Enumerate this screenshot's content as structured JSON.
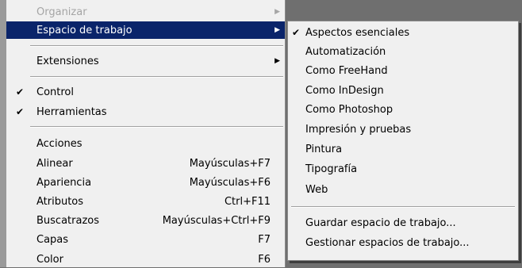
{
  "main_menu": {
    "organize": "Organizar",
    "workspace": "Espacio de trabajo",
    "extensions": "Extensiones",
    "control": "Control",
    "tools": "Herramientas",
    "panels": [
      {
        "label": "Acciones",
        "shortcut": ""
      },
      {
        "label": "Alinear",
        "shortcut": "Mayúsculas+F7"
      },
      {
        "label": "Apariencia",
        "shortcut": "Mayúsculas+F6"
      },
      {
        "label": "Atributos",
        "shortcut": "Ctrl+F11"
      },
      {
        "label": "Buscatrazos",
        "shortcut": "Mayúsculas+Ctrl+F9"
      },
      {
        "label": "Capas",
        "shortcut": "F7"
      },
      {
        "label": "Color",
        "shortcut": "F6"
      }
    ]
  },
  "submenu": {
    "workspaces": [
      "Aspectos esenciales",
      "Automatización",
      "Como FreeHand",
      "Como InDesign",
      "Como Photoshop",
      "Impresión y pruebas",
      "Pintura",
      "Tipografía",
      "Web"
    ],
    "save": "Guardar espacio de trabajo...",
    "manage": "Gestionar espacios de trabajo..."
  },
  "icons": {
    "check": "✔",
    "arrow": "▶"
  },
  "colors": {
    "highlight": "#0a246a",
    "menu_bg": "#f0f0f0",
    "disabled_text": "#a5a5a5"
  }
}
